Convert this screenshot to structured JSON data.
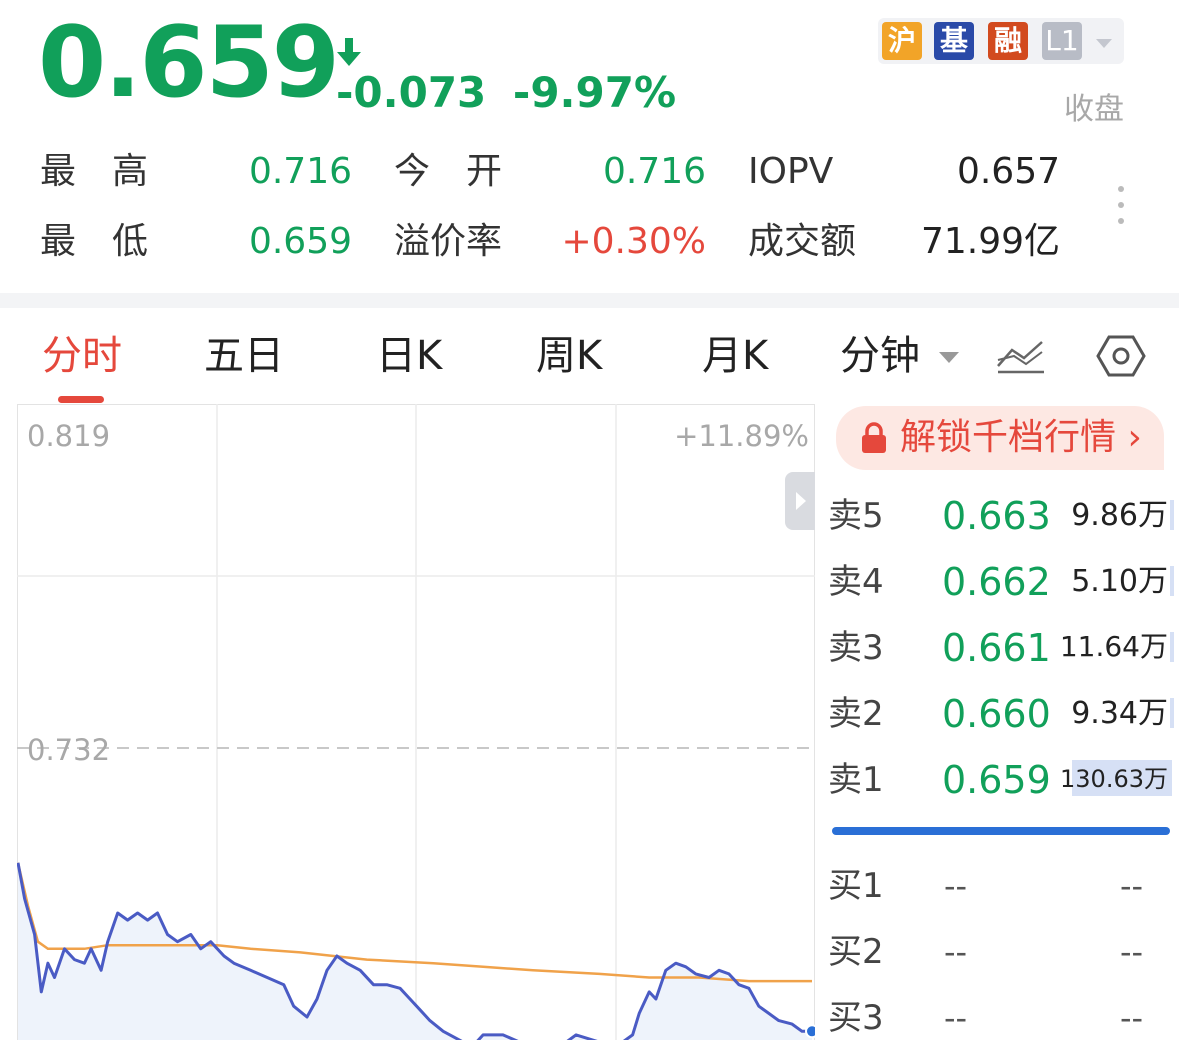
{
  "quote": {
    "price": "0.659",
    "change": "-0.073",
    "change_pct": "-9.97%",
    "status": "收盘",
    "badges": [
      {
        "label": "沪",
        "color": "#f2a428"
      },
      {
        "label": "基",
        "color": "#2a4aa8"
      },
      {
        "label": "融",
        "color": "#d24a1e"
      },
      {
        "label": "L1",
        "color": "#b8bcc6"
      }
    ]
  },
  "stats": {
    "high_label": "最　高",
    "high": "0.716",
    "open_label": "今　开",
    "open": "0.716",
    "iopv_label": "IOPV",
    "iopv": "0.657",
    "low_label": "最　低",
    "low": "0.659",
    "premium_label": "溢价率",
    "premium": "+0.30%",
    "turnover_label": "成交额",
    "turnover": "71.99亿"
  },
  "tabs": [
    "分时",
    "五日",
    "日K",
    "周K",
    "月K",
    "分钟"
  ],
  "active_tab": "分时",
  "icons": {
    "indicator": "chart-lines-icon",
    "settings": "hexagon-settings-icon",
    "lock": "lock-icon"
  },
  "chart": {
    "y_top": "0.819",
    "y_top_pct": "+11.89%",
    "y_mid": "0.732",
    "colors": {
      "price": "#4a5bc4",
      "avg": "#f0a24a",
      "grid": "#ececec",
      "area": "#eef3fb"
    },
    "chart_data": {
      "type": "line",
      "ylim": [
        0.645,
        0.819
      ],
      "x_sessions": 240,
      "series": [
        {
          "values": [
            [
              0,
              0.7
            ],
            [
              2,
              0.69
            ],
            [
              5,
              0.68
            ],
            [
              7,
              0.664
            ],
            [
              9,
              0.672
            ],
            [
              11,
              0.668
            ],
            [
              14,
              0.676
            ],
            [
              17,
              0.673
            ],
            [
              20,
              0.672
            ],
            [
              22,
              0.676
            ],
            [
              25,
              0.67
            ],
            [
              27,
              0.678
            ],
            [
              30,
              0.686
            ],
            [
              33,
              0.684
            ],
            [
              36,
              0.686
            ],
            [
              39,
              0.684
            ],
            [
              42,
              0.686
            ],
            [
              45,
              0.68
            ],
            [
              48,
              0.678
            ],
            [
              52,
              0.68
            ],
            [
              55,
              0.676
            ],
            [
              58,
              0.678
            ],
            [
              62,
              0.674
            ],
            [
              65,
              0.672
            ],
            [
              70,
              0.67
            ],
            [
              75,
              0.668
            ],
            [
              80,
              0.666
            ],
            [
              83,
              0.66
            ],
            [
              87,
              0.657
            ],
            [
              90,
              0.662
            ],
            [
              93,
              0.67
            ],
            [
              96,
              0.674
            ],
            [
              99,
              0.672
            ],
            [
              103,
              0.67
            ],
            [
              107,
              0.666
            ],
            [
              111,
              0.666
            ],
            [
              115,
              0.665
            ],
            [
              118,
              0.662
            ],
            [
              121,
              0.659
            ],
            [
              124,
              0.656
            ],
            [
              128,
              0.653
            ],
            [
              134,
              0.65
            ],
            [
              138,
              0.65
            ],
            [
              140,
              0.652
            ],
            [
              146,
              0.652
            ],
            [
              151,
              0.65
            ],
            [
              156,
              0.65
            ],
            [
              160,
              0.65
            ],
            [
              165,
              0.65
            ],
            [
              168,
              0.652
            ],
            [
              175,
              0.65
            ],
            [
              178,
              0.65
            ],
            [
              182,
              0.65
            ],
            [
              185,
              0.652
            ],
            [
              187,
              0.658
            ],
            [
              190,
              0.664
            ],
            [
              192,
              0.662
            ],
            [
              195,
              0.67
            ],
            [
              198,
              0.672
            ],
            [
              201,
              0.671
            ],
            [
              204,
              0.669
            ],
            [
              208,
              0.668
            ],
            [
              211,
              0.67
            ],
            [
              214,
              0.669
            ],
            [
              217,
              0.666
            ],
            [
              220,
              0.665
            ],
            [
              223,
              0.66
            ],
            [
              226,
              0.658
            ],
            [
              229,
              0.656
            ],
            [
              233,
              0.655
            ],
            [
              236,
              0.653
            ],
            [
              239,
              0.653
            ]
          ]
        },
        {
          "values": [
            [
              0,
              0.7
            ],
            [
              3,
              0.688
            ],
            [
              6,
              0.678
            ],
            [
              9,
              0.676
            ],
            [
              20,
              0.676
            ],
            [
              27,
              0.677
            ],
            [
              60,
              0.677
            ],
            [
              70,
              0.676
            ],
            [
              85,
              0.675
            ],
            [
              105,
              0.673
            ],
            [
              125,
              0.672
            ],
            [
              140,
              0.671
            ],
            [
              155,
              0.67
            ],
            [
              175,
              0.669
            ],
            [
              190,
              0.668
            ],
            [
              205,
              0.668
            ],
            [
              220,
              0.667
            ],
            [
              239,
              0.667
            ]
          ]
        }
      ]
    }
  },
  "orderbook": {
    "unlock": "解锁千档行情 ›",
    "asks": [
      {
        "label": "卖5",
        "price": "0.663",
        "vol": "9.86万"
      },
      {
        "label": "卖4",
        "price": "0.662",
        "vol": "5.10万"
      },
      {
        "label": "卖3",
        "price": "0.661",
        "vol": "11.64万"
      },
      {
        "label": "卖2",
        "price": "0.660",
        "vol": "9.34万"
      },
      {
        "label": "卖1",
        "price": "0.659",
        "vol": "130.63万"
      }
    ],
    "bids": [
      {
        "label": "买1",
        "price": "--",
        "vol": "--"
      },
      {
        "label": "买2",
        "price": "--",
        "vol": "--"
      },
      {
        "label": "买3",
        "price": "--",
        "vol": "--"
      }
    ]
  }
}
